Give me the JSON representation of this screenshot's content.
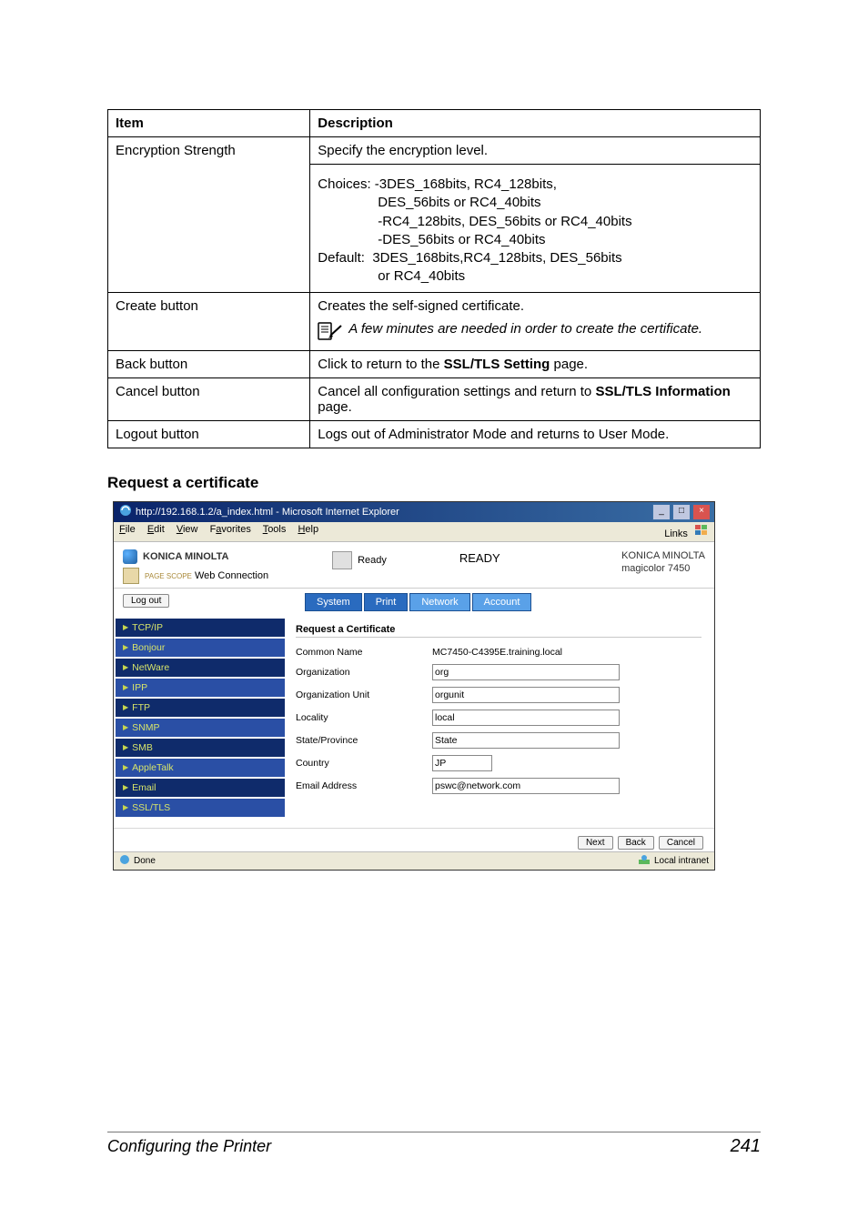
{
  "table": {
    "header_item": "Item",
    "header_desc": "Description",
    "rows": [
      {
        "item": "Encryption Strength",
        "desc_line1": "Specify the encryption level.",
        "choices_label": "Choices:",
        "choices_l1": "-3DES_168bits, RC4_128bits,",
        "choices_l2": "DES_56bits or RC4_40bits",
        "choices_l3": "-RC4_128bits, DES_56bits or RC4_40bits",
        "choices_l4": "-DES_56bits or RC4_40bits",
        "default_label": "Default:",
        "default_l1": "3DES_168bits,RC4_128bits, DES_56bits",
        "default_l2": "or RC4_40bits"
      },
      {
        "item": "Create button",
        "desc_line1": "Creates the self-signed certificate.",
        "note": "A few minutes are needed in order to create the certificate."
      },
      {
        "item": "Back button",
        "desc_pre": "Click to return to the ",
        "desc_bold": "SSL/TLS Setting",
        "desc_post": " page."
      },
      {
        "item": "Cancel button",
        "desc_pre": "Cancel all configuration settings and return to ",
        "desc_bold": "SSL/TLS Information",
        "desc_post": " page."
      },
      {
        "item": "Logout button",
        "desc_line1": "Logs out of Administrator Mode and returns to User Mode."
      }
    ]
  },
  "section_heading": "Request a certificate",
  "ie": {
    "title_prefix": "http://192.168.1.2/a_index.html - Microsoft Internet Explorer",
    "menu_file": "File",
    "menu_edit": "Edit",
    "menu_view": "View",
    "menu_fav": "Favorites",
    "menu_tools": "Tools",
    "menu_help": "Help",
    "links": "Links",
    "brand": "KONICA MINOLTA",
    "page_label": "PAGE SCOPE",
    "webconn": "Web Connection",
    "ready_small": "Ready",
    "ready_big": "READY",
    "right_line1": "KONICA MINOLTA",
    "right_line2": "magicolor 7450",
    "logout": "Log out",
    "tab_system": "System",
    "tab_print": "Print",
    "tab_network": "Network",
    "tab_account": "Account",
    "sidebar": [
      "TCP/IP",
      "Bonjour",
      "NetWare",
      "IPP",
      "FTP",
      "SNMP",
      "SMB",
      "AppleTalk",
      "Email",
      "SSL/TLS"
    ],
    "form_title": "Request a Certificate",
    "f_common_lbl": "Common Name",
    "f_common_val": "MC7450-C4395E.training.local",
    "f_org_lbl": "Organization",
    "f_org_val": "org",
    "f_orgunit_lbl": "Organization Unit",
    "f_orgunit_val": "orgunit",
    "f_locality_lbl": "Locality",
    "f_locality_val": "local",
    "f_state_lbl": "State/Province",
    "f_state_val": "State",
    "f_country_lbl": "Country",
    "f_country_val": "JP",
    "f_email_lbl": "Email Address",
    "f_email_val": "pswc@network.com",
    "btn_next": "Next",
    "btn_back": "Back",
    "btn_cancel": "Cancel",
    "status_done": "Done",
    "status_zone": "Local intranet"
  },
  "footer": {
    "left": "Configuring the Printer",
    "right": "241"
  }
}
